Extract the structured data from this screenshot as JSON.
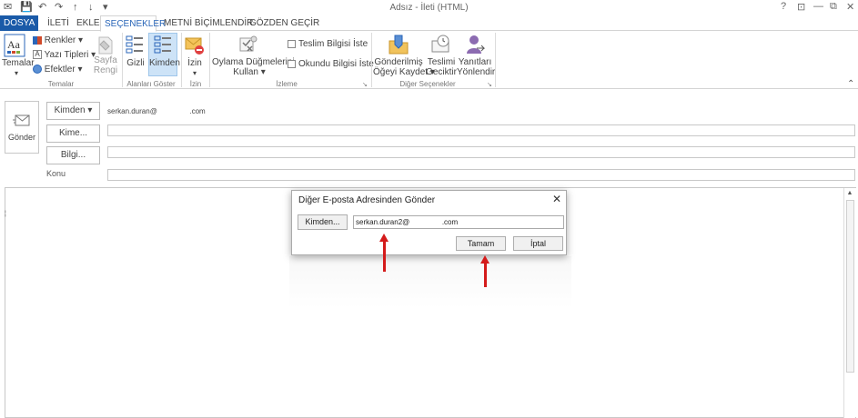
{
  "window": {
    "title": "Adsız - İleti (HTML)",
    "controls": {
      "help": "?",
      "restore_ribbon": "⊡",
      "minimize": "—",
      "restore": "⧉",
      "close": "✕"
    }
  },
  "quick_access": {
    "save": "💾",
    "undo": "↶",
    "redo": "↷",
    "up": "↑",
    "down": "↓",
    "more": "▾"
  },
  "tabs": [
    "DOSYA",
    "İLETİ",
    "EKLE",
    "SEÇENEKLER",
    "METNİ BİÇİMLENDİR",
    "GÖZDEN GEÇİR"
  ],
  "ribbon": {
    "temalar": {
      "label": "Temalar",
      "group": "Temalar",
      "renkler": "Renkler",
      "yazi_tipleri": "Yazı Tipleri",
      "efektler": "Efektler",
      "sayfa_rengi_1": "Sayfa",
      "sayfa_rengi_2": "Rengi"
    },
    "alanlari_goster": {
      "gizli": "Gizli",
      "kimden": "Kimden",
      "group": "Alanları Göster"
    },
    "izin": {
      "label": "İzin",
      "group": "İzin"
    },
    "izleme": {
      "oylama_1": "Oylama Düğmelerini",
      "oylama_2": "Kullan",
      "teslim": "Teslim Bilgisi İste",
      "okundu": "Okundu Bilgisi İste",
      "group": "İzleme"
    },
    "diger": {
      "gonderilmis_1": "Gönderilmiş",
      "gonderilmis_2": "Öğeyi Kaydet",
      "teslimi_1": "Teslimi",
      "teslimi_2": "Geciktir",
      "yanitlari_1": "Yanıtları",
      "yanitlari_2": "Yönlendir",
      "group": "Diğer Seçenekler"
    }
  },
  "compose": {
    "send": "Gönder",
    "from_btn": "Kimden",
    "from_value": "serkan.duran@                .com",
    "to_btn": "Kime...",
    "cc_btn": "Bilgi...",
    "subject_label": "Konu"
  },
  "dialog": {
    "title": "Diğer E-posta Adresinden Gönder",
    "from_btn": "Kimden...",
    "address": "serkan.duran2@                .com",
    "ok": "Tamam",
    "cancel": "İptal"
  }
}
